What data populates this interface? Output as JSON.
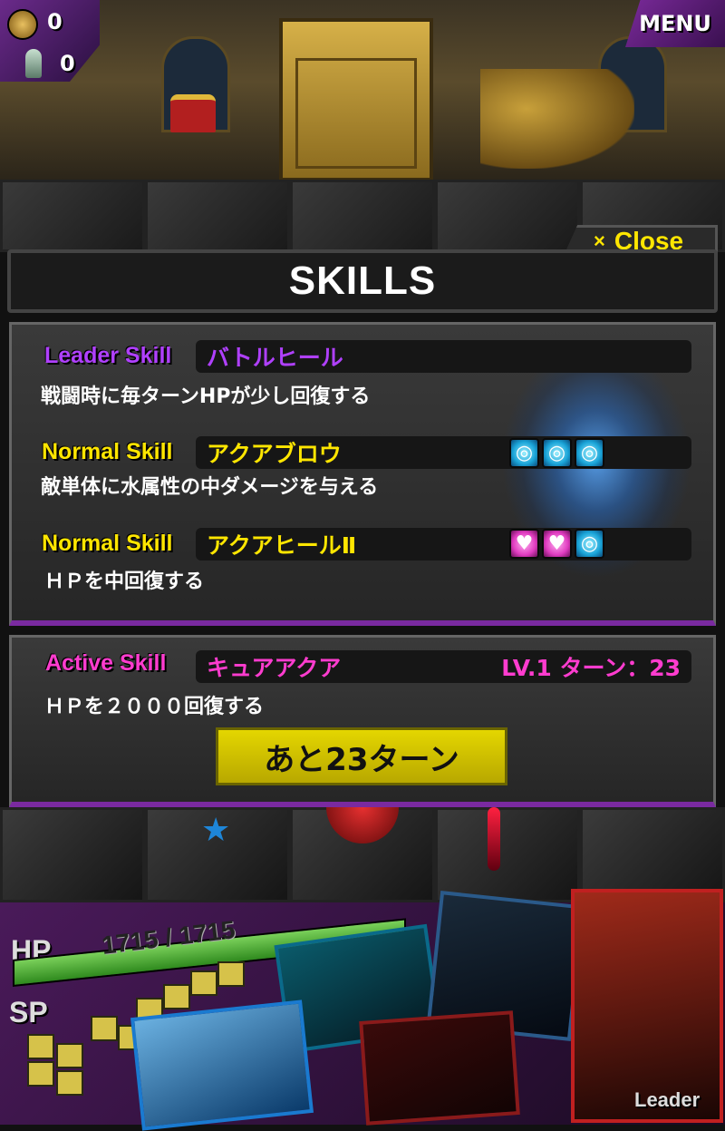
{
  "hud": {
    "coins_count": "0",
    "pawns_count": "0",
    "menu_label": "MENU"
  },
  "dialog": {
    "title": "SKILLS",
    "close_label": "Close",
    "close_icon": "×"
  },
  "skills": [
    {
      "type_label": "Leader Skill",
      "type_color": "#b040ff",
      "name": "バトルヒール",
      "name_color": "#b040ff",
      "description": "戦闘時に毎ターンHPが少し回復する",
      "orbs": []
    },
    {
      "type_label": "Normal Skill",
      "type_color": "#ffe600",
      "name": "アクアブロウ",
      "name_color": "#ffe600",
      "description": "敵単体に水属性の中ダメージを与える",
      "orbs": [
        "water-orb-icon",
        "water-orb-icon",
        "water-orb-icon"
      ]
    },
    {
      "type_label": "Normal Skill",
      "type_color": "#ffe600",
      "name": "アクアヒールⅡ",
      "name_color": "#ffe600",
      "description": "ＨＰを中回復する",
      "orbs": [
        "heart-orb-icon",
        "heart-orb-icon",
        "water-orb-icon"
      ]
    }
  ],
  "active_skill": {
    "type_label": "Active Skill",
    "type_color": "#ff3ccf",
    "name": "キュアアクア",
    "name_color": "#ff3ccf",
    "level_turn": "LV.1  ターン：23",
    "description": "ＨＰを２０００回復する",
    "wait_button_label": "あと23ターン"
  },
  "status": {
    "hp_label": "HP",
    "sp_label": "SP",
    "hp_text": "1715 / 1715",
    "hp_current": 1715,
    "hp_max": 1715,
    "leader_label": "Leader"
  }
}
